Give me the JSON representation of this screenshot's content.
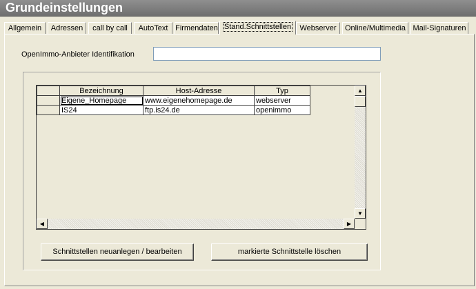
{
  "window": {
    "title": "Grundeinstellungen"
  },
  "tabs": [
    {
      "label": "Allgemein"
    },
    {
      "label": "Adressen"
    },
    {
      "label": "call by call"
    },
    {
      "label": "AutoText"
    },
    {
      "label": "Firmendaten"
    },
    {
      "label": "Stand.Schnittstellen",
      "active": true
    },
    {
      "label": "Webserver"
    },
    {
      "label": "Online/Multimedia"
    },
    {
      "label": "Mail-Signaturen"
    }
  ],
  "form": {
    "anbieter_label": "OpenImmo-Anbieter Identifikation",
    "anbieter_value": ""
  },
  "grid": {
    "columns": [
      "Bezeichnung",
      "Host-Adresse",
      "Typ"
    ],
    "rows": [
      [
        "Eigene_Homepage",
        "www.eigenehomepage.de",
        "webserver"
      ],
      [
        "IS24",
        "ftp.is24.de",
        "openimmo"
      ]
    ]
  },
  "buttons": {
    "new_edit": "Schnittstellen neuanlegen / bearbeiten",
    "delete": "markierte Schnittstelle löschen"
  }
}
